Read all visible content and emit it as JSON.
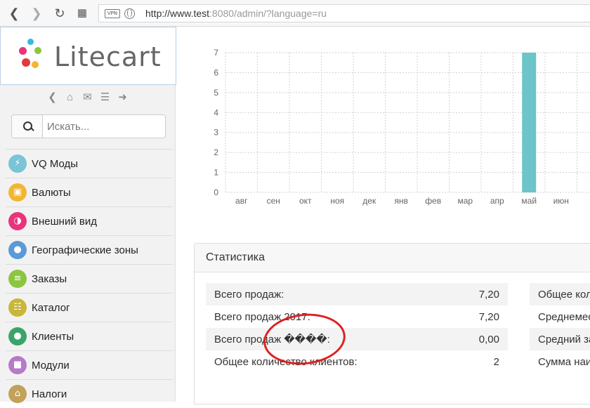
{
  "browser": {
    "url_host": "http://www.test",
    "url_rest": ":8080/admin/?language=ru",
    "vpn_label": "VPN"
  },
  "sidebar": {
    "logo_text": "Litecart",
    "search_placeholder": "Искать...",
    "menu": [
      {
        "label": "VQ Моды",
        "icon": "plug-icon",
        "color": "#79c4d6"
      },
      {
        "label": "Валюты",
        "icon": "money-icon",
        "color": "#f2b632"
      },
      {
        "label": "Внешний вид",
        "icon": "adjust-icon",
        "color": "#e8347a"
      },
      {
        "label": "Географические зоны",
        "icon": "globe-icon",
        "color": "#5a9ad8"
      },
      {
        "label": "Заказы",
        "icon": "cart-icon",
        "color": "#8cc63f"
      },
      {
        "label": "Каталог",
        "icon": "grid-icon",
        "color": "#c9b63a"
      },
      {
        "label": "Клиенты",
        "icon": "user-icon",
        "color": "#3aa56a"
      },
      {
        "label": "Модули",
        "icon": "cube-icon",
        "color": "#b57ac9"
      },
      {
        "label": "Налоги",
        "icon": "bank-icon",
        "color": "#c2a15a"
      }
    ]
  },
  "chart_data": {
    "type": "bar",
    "categories": [
      "авг",
      "сен",
      "окт",
      "ноя",
      "дек",
      "янв",
      "фев",
      "мар",
      "апр",
      "май",
      "июн",
      "★"
    ],
    "values": [
      0,
      0,
      0,
      0,
      0,
      0,
      0,
      0,
      0,
      7,
      0,
      0
    ],
    "ylim": [
      0,
      7
    ],
    "yticks": [
      0,
      1,
      2,
      3,
      4,
      5,
      6,
      7
    ],
    "grid": true,
    "bar_color": "#6cc5c8"
  },
  "stats": {
    "title": "Статистика",
    "rows": [
      {
        "label": "Всего продаж:",
        "value": "7,20"
      },
      {
        "label": "Всего продаж 2017:",
        "value": "7,20"
      },
      {
        "label": "Всего продаж ����:",
        "value": "0,00"
      },
      {
        "label": "Общее количество клиентов:",
        "value": "2"
      }
    ],
    "rows2": [
      {
        "label": "Общее количество"
      },
      {
        "label": "Среднемесячный"
      },
      {
        "label": "Средний заказ"
      },
      {
        "label": "Сумма наибольшего"
      }
    ]
  }
}
